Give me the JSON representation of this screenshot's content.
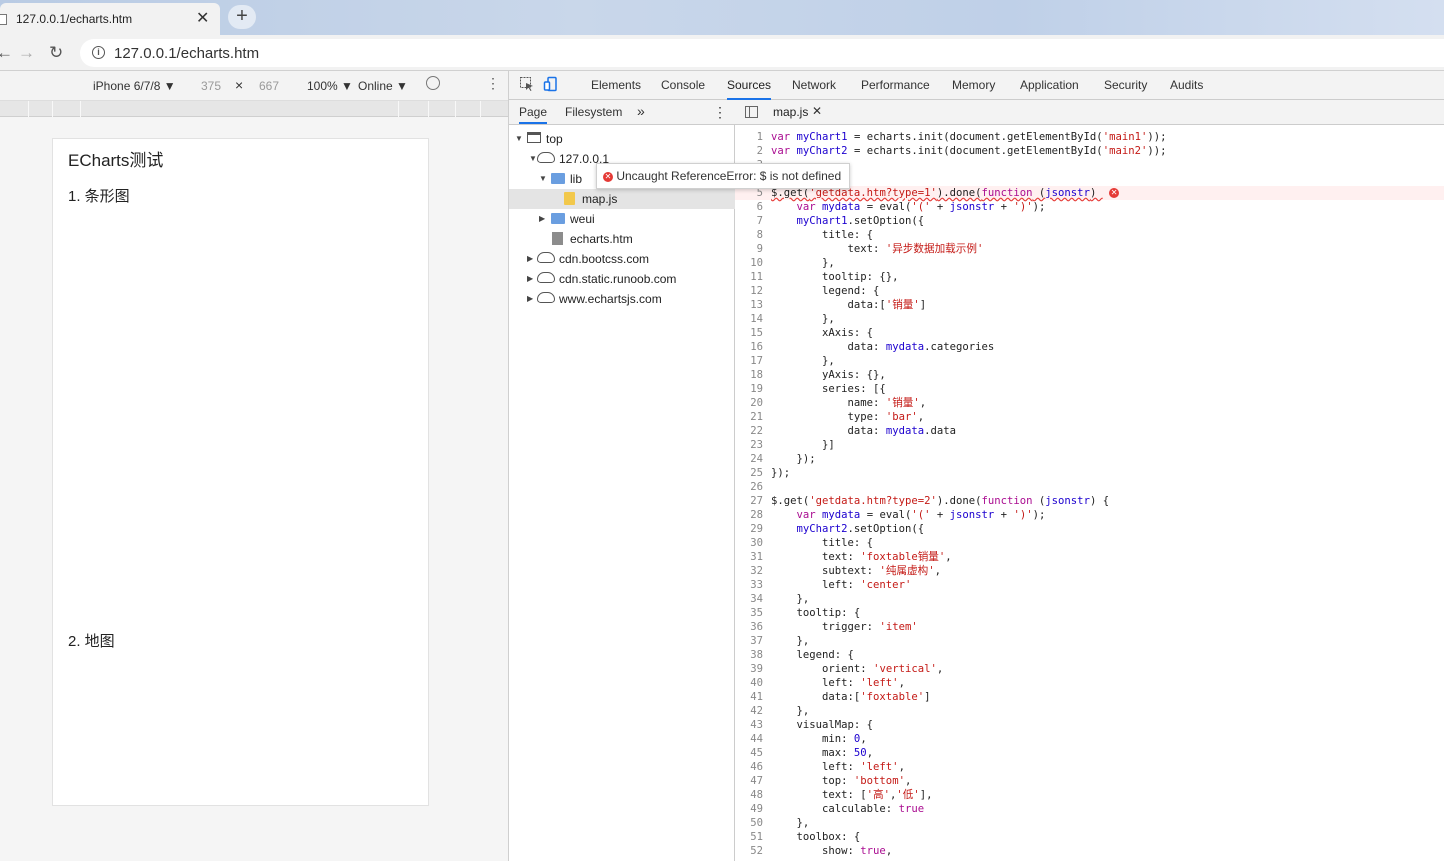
{
  "browser": {
    "tab_title": "127.0.0.1/echarts.htm",
    "new_tab_label": "+",
    "url": "127.0.0.1/echarts.htm"
  },
  "device_bar": {
    "device": "iPhone 6/7/8 ▼",
    "width": "375",
    "times": "×",
    "height": "667",
    "zoom": "100% ▼",
    "network": "Online ▼"
  },
  "page": {
    "title": "ECharts测试",
    "section1": "1. 条形图",
    "section2": "2. 地图"
  },
  "devtools": {
    "tabs": [
      "Elements",
      "Console",
      "Sources",
      "Network",
      "Performance",
      "Memory",
      "Application",
      "Security",
      "Audits"
    ],
    "active_tab": "Sources",
    "nav_tabs": [
      "Page",
      "Filesystem",
      "»"
    ],
    "tree": [
      "top",
      "127.0.0.1",
      "lib",
      "map.js",
      "weui",
      "echarts.htm",
      "cdn.bootcss.com",
      "cdn.static.runoob.com",
      "www.echartsjs.com"
    ],
    "editor_tab": "map.js",
    "error_message": "Uncaught ReferenceError: $ is not defined"
  },
  "code_lines": [
    "var myChart1 = echarts.init(document.getElementById('main1'));",
    "var myChart2 = echarts.init(document.getElementById('main2'));",
    "",
    "",
    "$.get('getdata.htm?type=1').done(function (jsonstr) ",
    "    var mydata = eval('(' + jsonstr + ')');",
    "    myChart1.setOption({",
    "        title: {",
    "            text: '异步数据加载示例'",
    "        },",
    "        tooltip: {},",
    "        legend: {",
    "            data:['销量']",
    "        },",
    "        xAxis: {",
    "            data: mydata.categories",
    "        },",
    "        yAxis: {},",
    "        series: [{",
    "            name: '销量',",
    "            type: 'bar',",
    "            data: mydata.data",
    "        }]",
    "    });",
    "});",
    "",
    "$.get('getdata.htm?type=2').done(function (jsonstr) {",
    "    var mydata = eval('(' + jsonstr + ')');",
    "    myChart2.setOption({",
    "        title: {",
    "        text: 'foxtable销量',",
    "        subtext: '纯属虚构',",
    "        left: 'center'",
    "    },",
    "    tooltip: {",
    "        trigger: 'item'",
    "    },",
    "    legend: {",
    "        orient: 'vertical',",
    "        left: 'left',",
    "        data:['foxtable']",
    "    },",
    "    visualMap: {",
    "        min: 0,",
    "        max: 50,",
    "        left: 'left',",
    "        top: 'bottom',",
    "        text: ['高','低'],",
    "        calculable: true",
    "    },",
    "    toolbox: {",
    "        show: true,"
  ]
}
